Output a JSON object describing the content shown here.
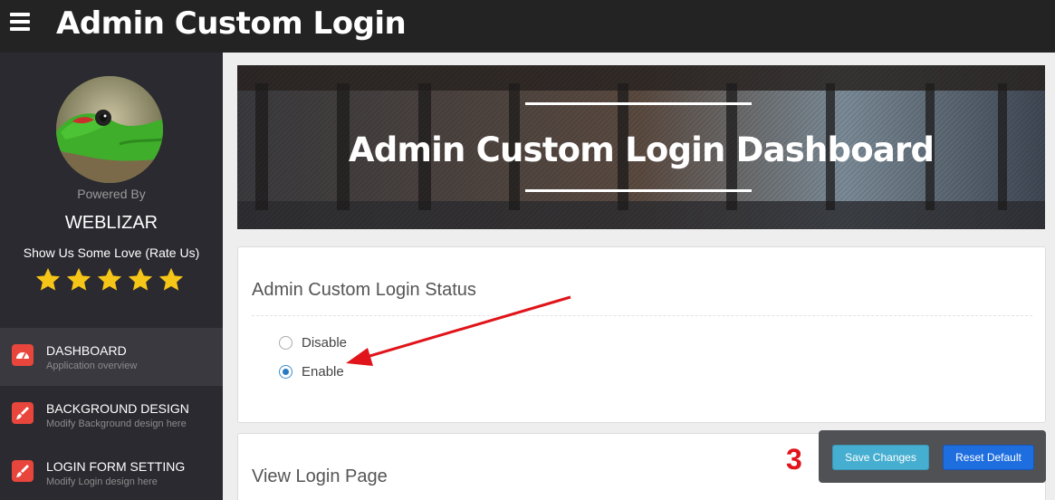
{
  "header": {
    "title": "Admin Custom Login"
  },
  "sidebar": {
    "powered_by": "Powered By",
    "brand": "WEBLIZAR",
    "rate_text": "Show Us Some Love (Rate Us)",
    "rating": 5,
    "items": [
      {
        "label": "DASHBOARD",
        "sub": "Application overview",
        "icon": "dashboard-icon",
        "active": true
      },
      {
        "label": "BACKGROUND DESIGN",
        "sub": "Modify Background design here",
        "icon": "brush-icon",
        "active": false
      },
      {
        "label": "LOGIN FORM SETTING",
        "sub": "Modify Login design here",
        "icon": "brush-icon",
        "active": false
      }
    ]
  },
  "hero": {
    "title": "Admin Custom Login Dashboard"
  },
  "status_card": {
    "title": "Admin Custom Login Status",
    "options": [
      {
        "label": "Disable",
        "checked": false
      },
      {
        "label": "Enable",
        "checked": true
      }
    ]
  },
  "view_card": {
    "title": "View Login Page"
  },
  "annotation": {
    "number": "3"
  },
  "actions": {
    "save_label": "Save Changes",
    "reset_label": "Reset Default"
  },
  "colors": {
    "topbar": "#232323",
    "sidebar": "#2b2a30",
    "nav_icon": "#e8463c",
    "star": "#f5c518",
    "save_button": "#46aed0",
    "reset_button": "#1e6ee0",
    "annotation": "#e0141a"
  }
}
